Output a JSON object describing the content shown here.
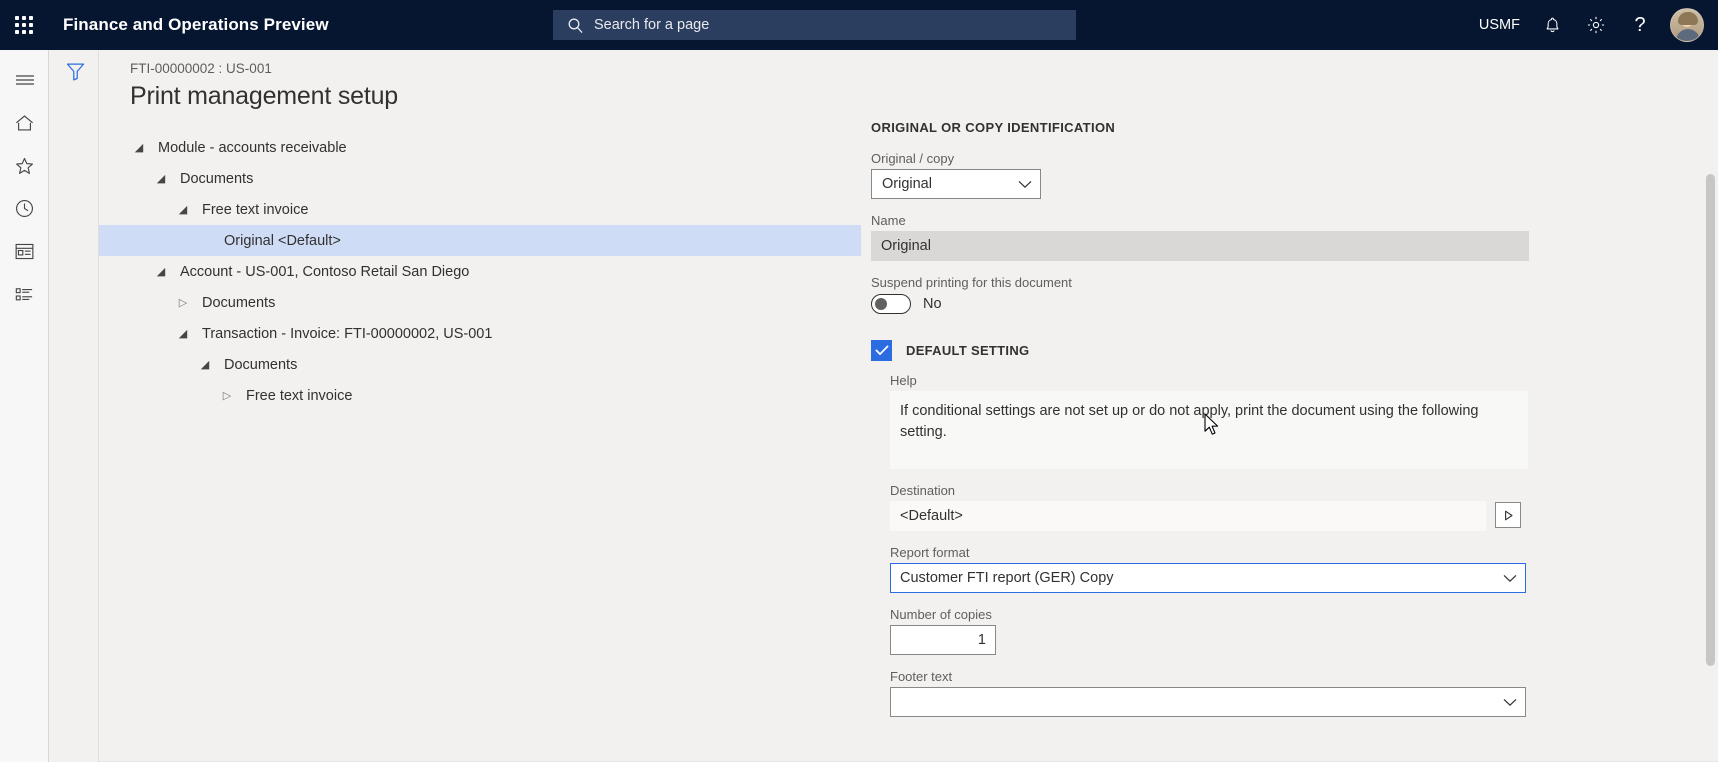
{
  "header": {
    "app_title": "Finance and Operations Preview",
    "waffle_icon": "app-launcher-icon",
    "search": {
      "placeholder": "Search for a page",
      "icon": "search-icon"
    },
    "company": "USMF",
    "notifications_icon": "bell-icon",
    "settings_icon": "gear-icon",
    "help_icon": "question-mark-icon",
    "avatar": "user-avatar",
    "background_color": "#061631",
    "search_background": "#2c3e60"
  },
  "nav_rail": {
    "items": [
      {
        "icon": "hamburger-menu-icon",
        "name": "expand-navigation"
      },
      {
        "icon": "home-icon",
        "name": "home"
      },
      {
        "icon": "star-icon",
        "name": "favorites"
      },
      {
        "icon": "clock-icon",
        "name": "recent"
      },
      {
        "icon": "workspace-icon",
        "name": "workspaces"
      },
      {
        "icon": "modules-list-icon",
        "name": "modules"
      }
    ]
  },
  "filter_pane": {
    "icon": "filter-funnel-icon",
    "color": "#2b6de0"
  },
  "page": {
    "breadcrumb": "FTI-00000002 : US-001",
    "title": "Print management setup"
  },
  "tree": {
    "nodes": [
      {
        "label": "Module - accounts receivable",
        "level": 0,
        "state": "expanded",
        "selected": false
      },
      {
        "label": "Documents",
        "level": 1,
        "state": "expanded",
        "selected": false
      },
      {
        "label": "Free text invoice",
        "level": 2,
        "state": "expanded",
        "selected": false
      },
      {
        "label": "Original <Default>",
        "level": 3,
        "state": "leaf",
        "selected": true
      },
      {
        "label": "Account - US-001, Contoso Retail San Diego",
        "level": 1,
        "state": "expanded",
        "selected": false
      },
      {
        "label": "Documents",
        "level": 2,
        "state": "collapsed",
        "selected": false
      },
      {
        "label": "Transaction - Invoice: FTI-00000002, US-001",
        "level": 2,
        "state": "expanded",
        "selected": false
      },
      {
        "label": "Documents",
        "level": 3,
        "state": "expanded",
        "selected": false
      },
      {
        "label": "Free text invoice",
        "level": 4,
        "state": "collapsed",
        "selected": false
      }
    ],
    "selection_color": "#cfdcf5"
  },
  "detail": {
    "section_title": "ORIGINAL OR COPY IDENTIFICATION",
    "original_copy": {
      "label": "Original / copy",
      "value": "Original",
      "chevron": "chevron-down-icon"
    },
    "name": {
      "label": "Name",
      "value": "Original"
    },
    "suspend": {
      "label": "Suspend printing for this document",
      "value": "No",
      "state": "off"
    },
    "default_setting": {
      "label": "DEFAULT SETTING",
      "checked": true,
      "color": "#2b6de0"
    },
    "help": {
      "label": "Help",
      "text": "If conditional settings are not set up or do not apply, print the document using the following setting."
    },
    "destination": {
      "label": "Destination",
      "value": "<Default>",
      "preview_icon": "print-preview-icon"
    },
    "report_format": {
      "label": "Report format",
      "value": "Customer FTI report (GER) Copy",
      "chevron": "chevron-down-icon",
      "focused": true
    },
    "number_of_copies": {
      "label": "Number of copies",
      "value": "1"
    },
    "footer_text": {
      "label": "Footer text",
      "value": "",
      "chevron": "chevron-down-icon"
    }
  },
  "scrollbar": {
    "name": "vertical-scrollbar"
  }
}
